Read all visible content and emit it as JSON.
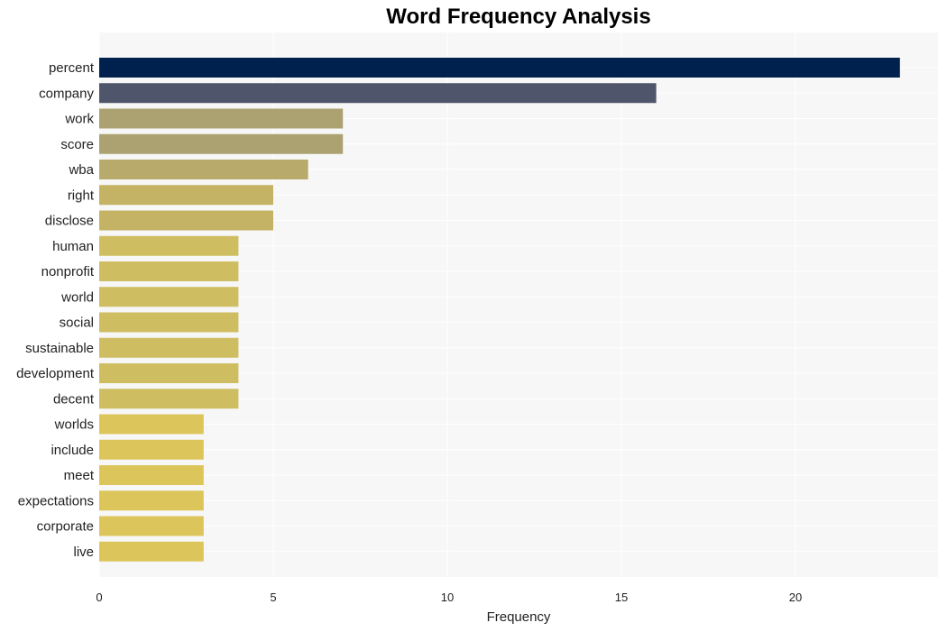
{
  "chart_data": {
    "type": "bar",
    "orientation": "horizontal",
    "title": "Word Frequency Analysis",
    "xlabel": "Frequency",
    "ylabel": "",
    "xlim": [
      0,
      24
    ],
    "xticks": [
      0,
      5,
      10,
      15,
      20
    ],
    "grid": true,
    "categories": [
      "percent",
      "company",
      "work",
      "score",
      "wba",
      "right",
      "disclose",
      "human",
      "nonprofit",
      "world",
      "social",
      "sustainable",
      "development",
      "decent",
      "worlds",
      "include",
      "meet",
      "expectations",
      "corporate",
      "live"
    ],
    "values": [
      23,
      16,
      7,
      7,
      6,
      5,
      5,
      4,
      4,
      4,
      4,
      4,
      4,
      4,
      3,
      3,
      3,
      3,
      3,
      3
    ],
    "colors": [
      "#00214d",
      "#4f556b",
      "#aca271",
      "#aca271",
      "#b8aa6a",
      "#c4b365",
      "#c4b365",
      "#cfbe61",
      "#cfbe61",
      "#cfbe61",
      "#cfbe61",
      "#cfbe61",
      "#cfbe61",
      "#cfbe61",
      "#dcc65b",
      "#dcc65b",
      "#dcc65b",
      "#dcc65b",
      "#dcc65b",
      "#dcc65b"
    ]
  }
}
